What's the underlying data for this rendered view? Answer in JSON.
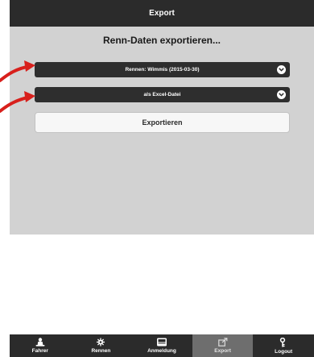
{
  "header": {
    "title": "Export"
  },
  "main": {
    "heading": "Renn-Daten exportieren...",
    "race_select": {
      "value": "Rennen: Wimmis (2015-03-30)"
    },
    "format_select": {
      "value": "als Excel-Datei"
    },
    "export_button": {
      "label": "Exportieren"
    }
  },
  "tabbar": {
    "tabs": [
      {
        "label": "Fahrer",
        "icon": "rider-icon"
      },
      {
        "label": "Rennen",
        "icon": "gear-icon"
      },
      {
        "label": "Anmeldung",
        "icon": "inbox-icon"
      },
      {
        "label": "Export",
        "icon": "export-icon",
        "active": true
      },
      {
        "label": "Logout",
        "icon": "key-icon"
      }
    ]
  },
  "colors": {
    "header_bg": "#2b2b2b",
    "content_bg": "#d2d2d2",
    "active_tab_bg": "#6e6e6e",
    "annotation_arrow": "#d8201c"
  }
}
